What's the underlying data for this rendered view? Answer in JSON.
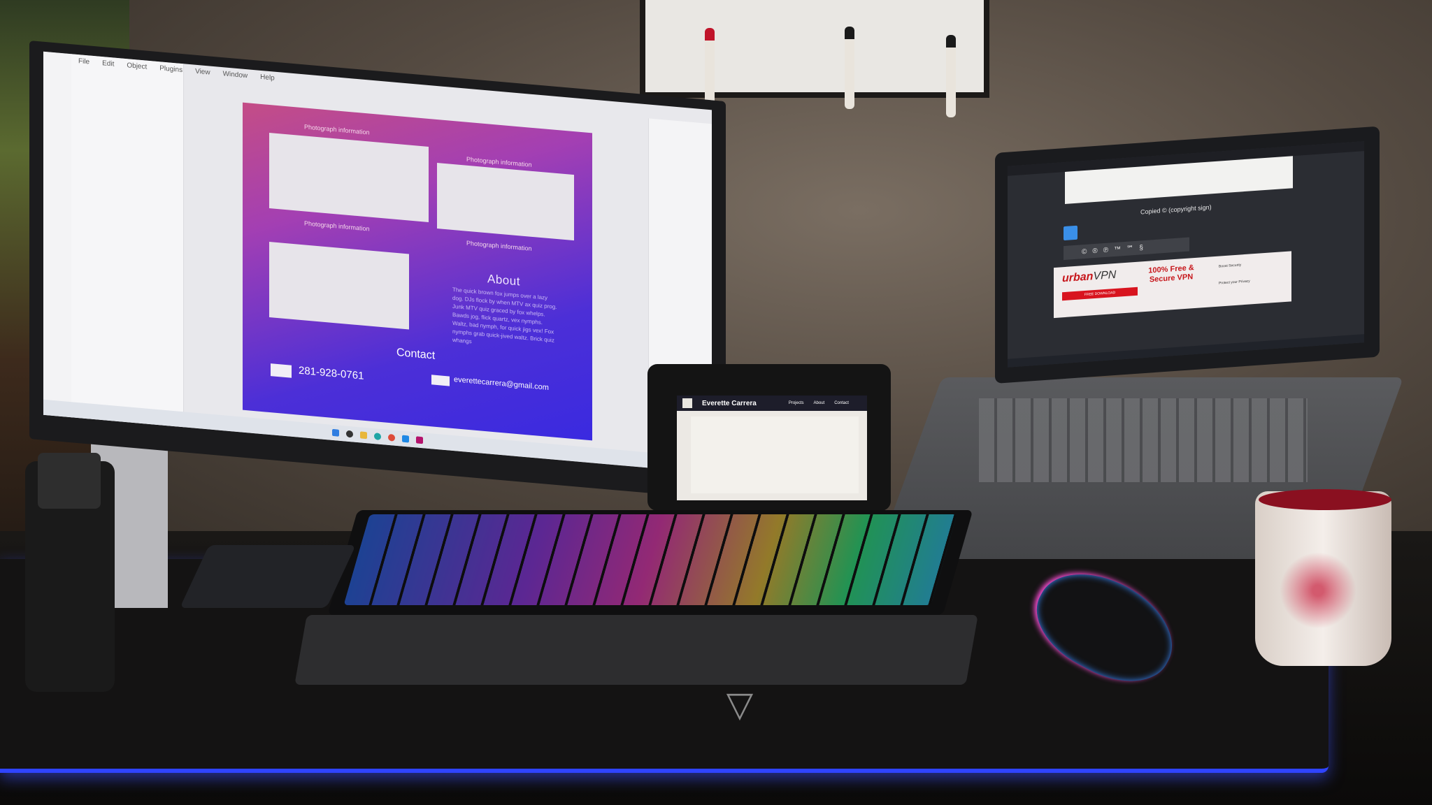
{
  "photo": {
    "main_monitor": {
      "menu_items": [
        "File",
        "Edit",
        "Object",
        "Plugins",
        "View",
        "Window",
        "Help"
      ],
      "artboard": {
        "captions": [
          "Photograph information",
          "Photograph information",
          "Photograph information",
          "Photograph information"
        ],
        "about_heading": "About",
        "about_text": "The quick brown fox jumps over a lazy dog. DJs flock by when MTV ax quiz prog. Junk MTV quiz graced by fox whelps. Bawds jog, flick quartz, vex nymphs. Waltz, bad nymph, for quick jigs vex! Fox nymphs grab quick-jived waltz. Brick quiz whangs",
        "contact_heading": "Contact",
        "phone": "281-928-0761",
        "email": "everettecarrera@gmail.com"
      }
    },
    "tablet": {
      "site_name": "Everette Carrera",
      "nav": [
        "Projects",
        "About",
        "Contact"
      ]
    },
    "laptop": {
      "copied_label": "Copied © (copyright sign)",
      "symbols": [
        "©",
        "®",
        "℗",
        "™",
        "℠",
        "§"
      ],
      "ad": {
        "brand_red": "urban",
        "brand_gray": "VPN",
        "headline": "100% Free & Secure VPN",
        "cta": "FREE DOWNLOAD",
        "feature_1": "Boost Security",
        "feature_2": "Protect your Privacy"
      }
    },
    "colors": {
      "deskmat_glow": "#2f44ff",
      "artboard_gradient_start": "#c44d86",
      "artboard_gradient_end": "#3a2ae0"
    }
  }
}
